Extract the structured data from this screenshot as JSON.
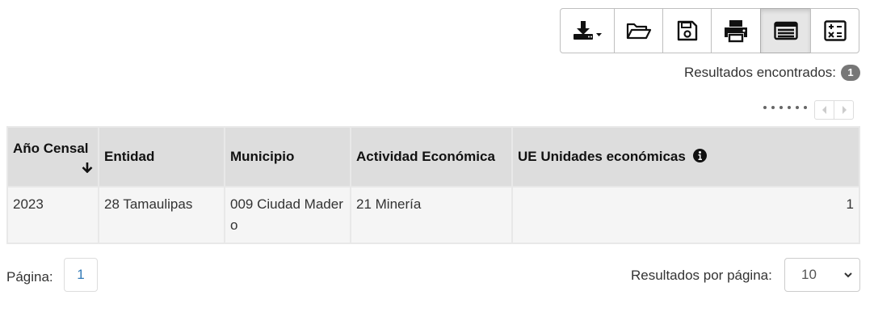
{
  "toolbar": {
    "buttons": [
      {
        "name": "download-menu",
        "icon": "download-icon",
        "active": false
      },
      {
        "name": "open",
        "icon": "folder-open-icon",
        "active": false
      },
      {
        "name": "save",
        "icon": "save-icon",
        "active": false
      },
      {
        "name": "print",
        "icon": "print-icon",
        "active": false
      },
      {
        "name": "table-view",
        "icon": "table-view-icon",
        "active": true
      },
      {
        "name": "calculator",
        "icon": "calculator-icon",
        "active": false
      }
    ]
  },
  "results": {
    "label": "Resultados encontrados:",
    "count": "1"
  },
  "table": {
    "columns": [
      "Año Censal",
      "Entidad",
      "Municipio",
      "Actividad Económica",
      "UE Unidades económicas"
    ],
    "rows": [
      [
        "2023",
        "28 Tamaulipas",
        "009 Ciudad Madero",
        "21 Minería",
        "1"
      ]
    ]
  },
  "pagination": {
    "label": "Página:",
    "current": "1",
    "per_page_label": "Resultados por página:",
    "per_page_value": "10"
  },
  "colors": {
    "header_bg": "#dddddd",
    "row_bg": "#f5f5f5",
    "badge_bg": "#777777",
    "link": "#337ab7"
  }
}
